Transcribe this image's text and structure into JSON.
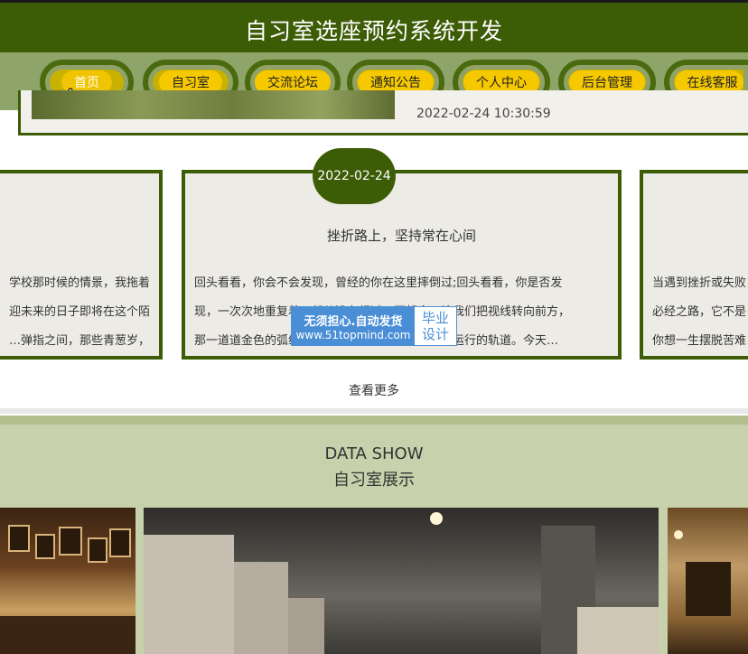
{
  "header": {
    "title": "自习室选座预约系统开发"
  },
  "nav": {
    "items": [
      {
        "label": "首页",
        "active": true
      },
      {
        "label": "自习室",
        "active": false
      },
      {
        "label": "交流论坛",
        "active": false
      },
      {
        "label": "通知公告",
        "active": false
      },
      {
        "label": "个人中心",
        "active": false
      },
      {
        "label": "后台管理",
        "active": false
      },
      {
        "label": "在线客服",
        "active": false
      }
    ]
  },
  "prev_card": {
    "time": "2022-02-24 10:30:59"
  },
  "articles": [
    {
      "lines": [
        "学校那时候的情景，我拖着",
        "迎未来的日子即将在这个陌",
        "，弹指之间，那些青葱岁…"
      ]
    },
    {
      "date": "2022-02-24",
      "title": "挫折路上，坚持常在心间",
      "lines": [
        "回头看看，你会不会发现，曾经的你在这里摔倒过;回头看看，你是否发",
        "现，一次次地重复着，却从没有超过。面朝令，让我们把视线转向前方，",
        "那一道道金色的弧线将带你转向成功之路，是成功运行的轨道。今天…"
      ]
    },
    {
      "lines": [
        "当遇到挫折或失败",
        "必经之路，它不是",
        "你想一生摆脱苦难"
      ]
    }
  ],
  "more": {
    "label": "查看更多"
  },
  "watermark": {
    "line1": "无须担心.自动发货",
    "line2": "www.51topmind.com",
    "right1": "毕业",
    "right2": "设计"
  },
  "show": {
    "title_en": "DATA SHOW",
    "title_cn": "自习室展示"
  },
  "colors": {
    "primary": "#3d5c06",
    "nav_bg": "#8fa468",
    "pill": "#f5c800",
    "band": "#c7d1ac"
  }
}
